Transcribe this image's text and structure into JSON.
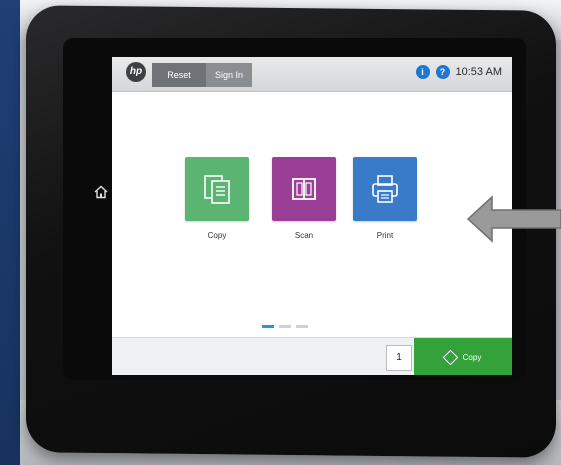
{
  "topbar": {
    "logo_text": "hp",
    "tabs": [
      {
        "label": "Reset"
      },
      {
        "label": "Sign In"
      }
    ],
    "info_icon": "i",
    "help_icon": "?",
    "time": "10:53 AM"
  },
  "apps": [
    {
      "label": "Copy",
      "icon": "copy-icon",
      "color": "#5bb472"
    },
    {
      "label": "Scan",
      "icon": "scan-icon",
      "color": "#9b3e95"
    },
    {
      "label": "Print",
      "icon": "print-icon",
      "color": "#3a7bc8"
    }
  ],
  "pager": {
    "pages": 3,
    "active": 1
  },
  "bottombar": {
    "quantity": "1",
    "action_label": "Copy",
    "action_color": "#33a23a"
  },
  "side": {
    "home_icon": "home-icon",
    "arrow_icon": "left-arrow-icon"
  }
}
